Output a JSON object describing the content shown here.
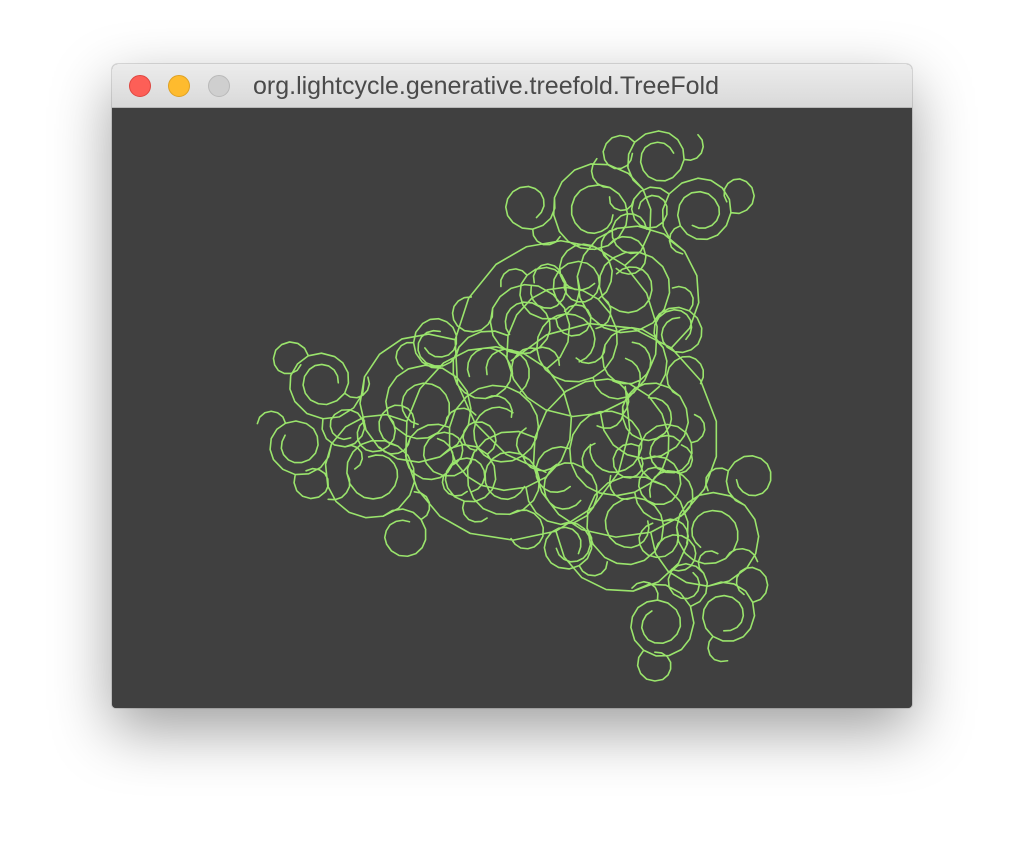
{
  "window": {
    "title": "org.lightcycle.generative.treefold.TreeFold",
    "buttons": {
      "close": {
        "fill": "#fd5f57",
        "border": "#de4640"
      },
      "minimize": {
        "fill": "#febb2e",
        "border": "#dea123"
      },
      "zoom": {
        "fill": "#cfcfcf",
        "border": "#b9b9b9"
      }
    }
  },
  "canvas": {
    "background": "#404040",
    "stroke_color": "#9ae46c",
    "pattern": "recursive-fractal-tree"
  }
}
